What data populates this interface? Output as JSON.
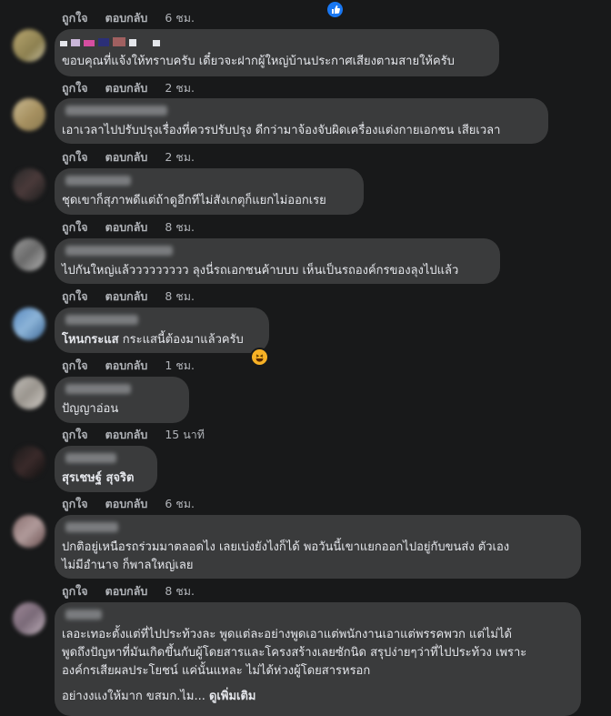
{
  "actions": {
    "like": "ถูกใจ",
    "reply": "ตอบกลับ"
  },
  "comments": [
    {
      "time": "6 ชม."
    },
    {
      "text": [
        "ขอบคุณที่แจ้งให้ทราบครับ เดี๋ยวจะฝากผู้ใหญ่บ้านประกาศเสียงตามสายให้ครับ"
      ],
      "time": "2 ชม."
    },
    {
      "text": [
        "เอาเวลาไปปรับปรุงเรื่องที่ควรปรับปรุง ดีกว่ามาจ้องจับผิดเครื่องแต่งกายเอกชน เสียเวลา"
      ],
      "time": "2 ชม."
    },
    {
      "text": [
        "ชุดเขาก็สุภาพดีแต่ถ้าดูอีกทีไม่สังเกตุก็แยกไม่ออกเรย"
      ],
      "time": "8 ชม."
    },
    {
      "text": [
        "ไปกันใหญ่แล้ววววววววว ลุงนี่รถเอกชนค้าบบบ เห็นเป็นรถองค์กรของลุงไปแล้ว"
      ],
      "time": "8 ชม."
    },
    {
      "tag": "โหนกระแส",
      "text": [
        "กระแสนี้ต้องมาแล้วครับ"
      ],
      "time": "1 ชม."
    },
    {
      "text": [
        "ปัญญาอ่อน"
      ],
      "time": "15 นาที"
    },
    {
      "tag": "สุรเชษฐ์ สุจริต",
      "time": "6 ชม."
    },
    {
      "text": [
        "ปกติอยู่เหนือรถร่วมมาตลอดไง เลยเบ่งยังไงก็ได้ พอวันนี้เขาแยกออกไปอยู่กับขนส่ง ตัวเอง",
        "ไม่มีอำนาจ ก็พาลใหญ่เลย"
      ],
      "time": "8 ชม."
    },
    {
      "text": [
        "เลอะเทอะตั้งแต่ที่ไปประท้วงละ พูดแต่ละอย่างพูดเอาแต่พนักงานเอาแต่พรรคพวก แต่ไม่ได้",
        "พูดถึงปัญหาที่มันเกิดขึ้นกับผู้โดยสารและโครงสร้างเลยซักนิด สรุปง่ายๆว่าที่ไปประท้วง เพราะ",
        "องค์กรเสียผลประโยชน์ แค่นั้นแหละ ไม่ได้ห่วงผู้โดยสารหรอก"
      ],
      "text_end": "อย่างงแงให้มาก ขสมก.ไม...",
      "see_more": "ดูเพิ่มเติม"
    }
  ],
  "colors": {
    "bg": "#18191a",
    "bubble": "#3a3b3c",
    "text": "#e4e6eb",
    "muted": "#b0b3b8",
    "like": "#1877f2",
    "haha": "#f7b125"
  },
  "icons": {
    "like": "thumbs-up",
    "haha": "laughing-face"
  }
}
